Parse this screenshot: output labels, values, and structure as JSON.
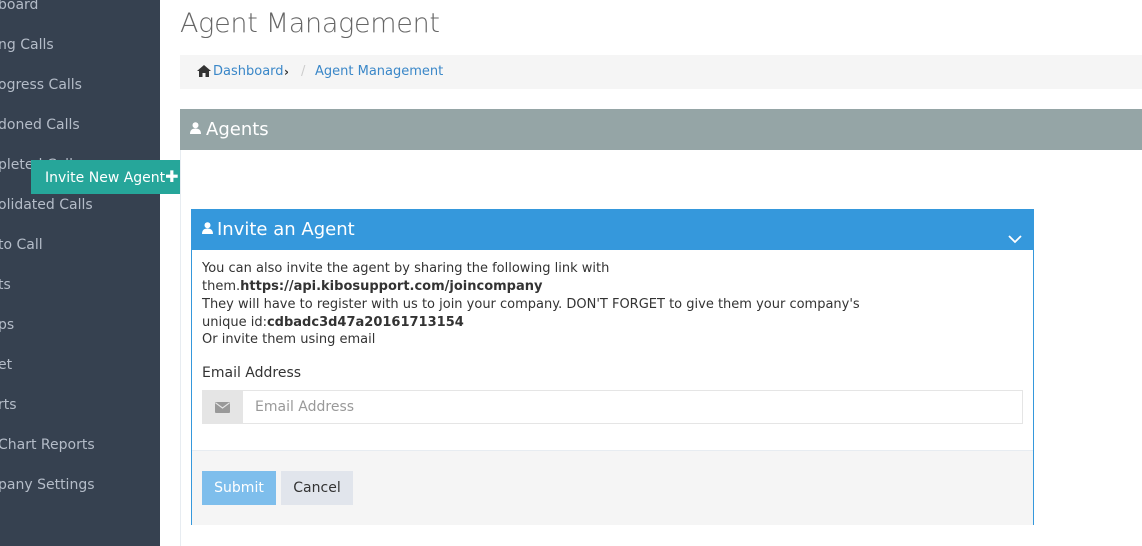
{
  "sidebar": {
    "items": [
      {
        "label": "board"
      },
      {
        "label": "ng Calls"
      },
      {
        "label": "ogress Calls"
      },
      {
        "label": "doned Calls"
      },
      {
        "label": "pleted Calls"
      },
      {
        "label": "olidated Calls"
      },
      {
        "label": " to Call"
      },
      {
        "label": "ts"
      },
      {
        "label": "ps"
      },
      {
        "label": "et"
      },
      {
        "label": "rts"
      },
      {
        "label": "Chart Reports"
      },
      {
        "label": "pany Settings"
      }
    ]
  },
  "page": {
    "title": "Agent Management"
  },
  "breadcrumb": {
    "dashboard": "Dashboard",
    "separator": "/",
    "current": "Agent Management"
  },
  "agents_panel": {
    "title": "Agents",
    "invite_button": "Invite New Agent"
  },
  "invite_panel": {
    "title": "Invite an Agent",
    "intro_prefix": "You can also invite the agent by sharing the following link with them.",
    "link": "https://api.kibosupport.com/joincompany",
    "register_text": "They will have to register with us to join your company. DON'T FORGET to give them your company's unique id:",
    "company_id": "cdbadc3d47a20161713154",
    "or_text": "Or invite them using email",
    "email_label": "Email Address",
    "email_placeholder": "Email Address",
    "email_value": "",
    "submit_label": "Submit",
    "cancel_label": "Cancel"
  },
  "colors": {
    "sidebar_bg": "#364150",
    "agents_header": "#95a5a6",
    "invite_button": "#26a69a",
    "invite_header": "#3598dc",
    "submit_button": "#7ebeec"
  },
  "icons": {
    "home": "home-icon",
    "user": "user-icon",
    "plus": "plus-icon",
    "chevron": "chevron-down-icon",
    "envelope": "envelope-icon"
  }
}
